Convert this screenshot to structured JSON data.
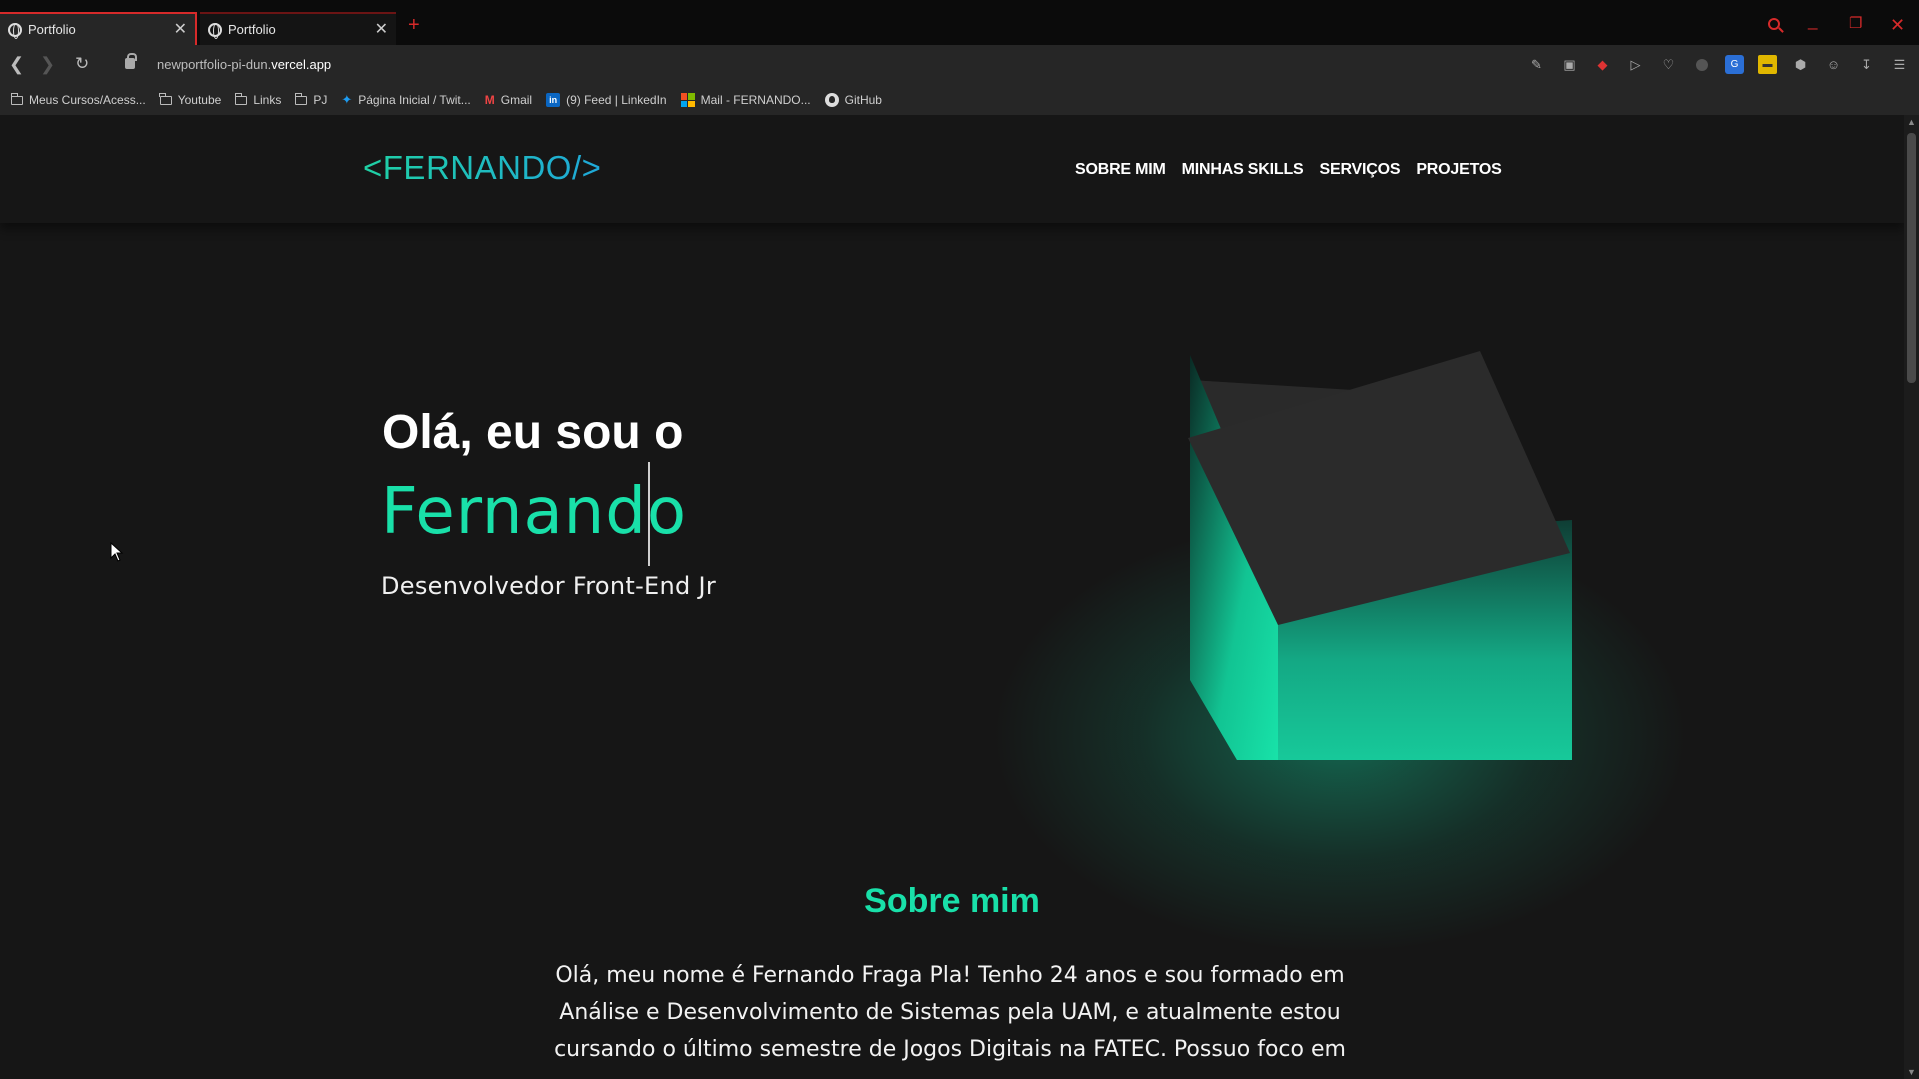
{
  "browser": {
    "tabs": [
      {
        "title": "Portfolio",
        "close": "✕"
      },
      {
        "title": "Portfolio",
        "close": "✕"
      }
    ],
    "new_tab": "+",
    "window_controls": {
      "search": "search-icon",
      "minimize": "_",
      "maximize": "❐",
      "close": "✕"
    },
    "url_prefix": "newportfolio-pi-dun.",
    "url_domain": "vercel.app",
    "bookmarks": [
      {
        "label": "Meus Cursos/Acess...",
        "icon": "folder-icon"
      },
      {
        "label": "Youtube",
        "icon": "folder-icon"
      },
      {
        "label": "Links",
        "icon": "folder-icon"
      },
      {
        "label": "PJ",
        "icon": "folder-icon"
      },
      {
        "label": "Página Inicial / Twit...",
        "icon": "twitter-icon"
      },
      {
        "label": "Gmail",
        "icon": "gmail-icon"
      },
      {
        "label": "(9) Feed | LinkedIn",
        "icon": "linkedin-icon"
      },
      {
        "label": "Mail - FERNANDO...",
        "icon": "microsoft-icon"
      },
      {
        "label": "GitHub",
        "icon": "github-icon"
      }
    ]
  },
  "site": {
    "logo": "<FERNANDO/>",
    "nav": [
      "SOBRE MIM",
      "MINHAS SKILLS",
      "SERVIÇOS",
      "PROJETOS"
    ],
    "hero": {
      "greeting": "Olá, eu sou o",
      "name": "Fernando",
      "role": "Desenvolvedor Front-End Jr"
    },
    "about": {
      "title": "Sobre mim",
      "lines": [
        "Olá, meu nome é Fernando Fraga Pla! Tenho 24 anos e sou formado em",
        "Análise e Desenvolvimento de Sistemas pela UAM, e atualmente estou",
        "cursando o último semestre de Jogos Digitais na FATEC. Possuo foco em"
      ]
    },
    "colors": {
      "accent": "#19e0a9",
      "background": "#161616",
      "logo_gradient_end": "#1fa8d9"
    }
  }
}
